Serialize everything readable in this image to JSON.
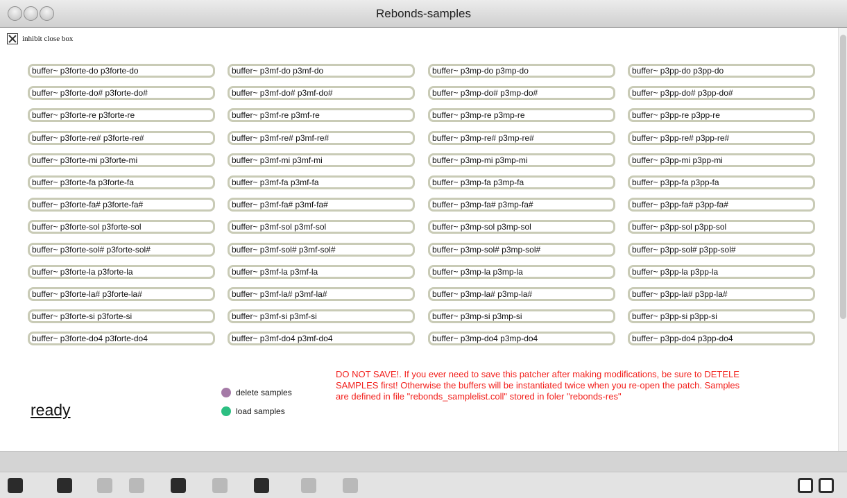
{
  "window": {
    "title": "Rebonds-samples"
  },
  "inhibit": {
    "label": "inhibit close box"
  },
  "buffers": {
    "col1": [
      "buffer~ p3forte-do p3forte-do",
      "buffer~ p3forte-do# p3forte-do#",
      "buffer~ p3forte-re p3forte-re",
      "buffer~ p3forte-re# p3forte-re#",
      "buffer~ p3forte-mi p3forte-mi",
      "buffer~ p3forte-fa p3forte-fa",
      "buffer~ p3forte-fa# p3forte-fa#",
      "buffer~ p3forte-sol p3forte-sol",
      "buffer~ p3forte-sol# p3forte-sol#",
      "buffer~ p3forte-la p3forte-la",
      "buffer~ p3forte-la# p3forte-la#",
      "buffer~ p3forte-si p3forte-si",
      "buffer~ p3forte-do4 p3forte-do4"
    ],
    "col2": [
      "buffer~ p3mf-do p3mf-do",
      "buffer~ p3mf-do# p3mf-do#",
      "buffer~ p3mf-re p3mf-re",
      "buffer~ p3mf-re# p3mf-re#",
      "buffer~ p3mf-mi p3mf-mi",
      "buffer~ p3mf-fa p3mf-fa",
      "buffer~ p3mf-fa# p3mf-fa#",
      "buffer~ p3mf-sol p3mf-sol",
      "buffer~ p3mf-sol# p3mf-sol#",
      "buffer~ p3mf-la p3mf-la",
      "buffer~ p3mf-la# p3mf-la#",
      "buffer~ p3mf-si p3mf-si",
      "buffer~ p3mf-do4 p3mf-do4"
    ],
    "col3": [
      "buffer~ p3mp-do p3mp-do",
      "buffer~ p3mp-do# p3mp-do#",
      "buffer~ p3mp-re p3mp-re",
      "buffer~ p3mp-re# p3mp-re#",
      "buffer~ p3mp-mi p3mp-mi",
      "buffer~ p3mp-fa p3mp-fa",
      "buffer~ p3mp-fa# p3mp-fa#",
      "buffer~ p3mp-sol p3mp-sol",
      "buffer~ p3mp-sol# p3mp-sol#",
      "buffer~ p3mp-la p3mp-la",
      "buffer~ p3mp-la# p3mp-la#",
      "buffer~ p3mp-si p3mp-si",
      "buffer~ p3mp-do4 p3mp-do4"
    ],
    "col4": [
      "buffer~ p3pp-do p3pp-do",
      "buffer~ p3pp-do# p3pp-do#",
      "buffer~ p3pp-re p3pp-re",
      "buffer~ p3pp-re# p3pp-re#",
      "buffer~ p3pp-mi p3pp-mi",
      "buffer~ p3pp-fa p3pp-fa",
      "buffer~ p3pp-fa# p3pp-fa#",
      "buffer~ p3pp-sol p3pp-sol",
      "buffer~ p3pp-sol# p3pp-sol#",
      "buffer~ p3pp-la p3pp-la",
      "buffer~ p3pp-la# p3pp-la#",
      "buffer~ p3pp-si p3pp-si",
      "buffer~ p3pp-do4 p3pp-do4"
    ]
  },
  "status": {
    "text": "ready"
  },
  "actions": {
    "delete_label": "delete samples",
    "load_label": "load samples",
    "delete_color": "#a57aa7",
    "load_color": "#2cbf82"
  },
  "warning": {
    "text": "DO NOT SAVE!. If you ever need to save this patcher after making modifications, be sure to DETELE SAMPLES first! Otherwise the buffers will be instantiated twice when you re-open the patch. Samples are defined in file \"rebonds_samplelist.coll\" stored in foler \"rebonds-res\"",
    "color": "#f2201c"
  },
  "toolbar": {
    "items": [
      "lock-icon",
      "new-view-icon",
      "patch-cord-icon",
      "delete-icon",
      "debug-icon",
      "info-icon",
      "inlet-icon",
      "grid-icon",
      "clock-icon",
      "left-pane-icon",
      "right-pane-icon"
    ]
  }
}
